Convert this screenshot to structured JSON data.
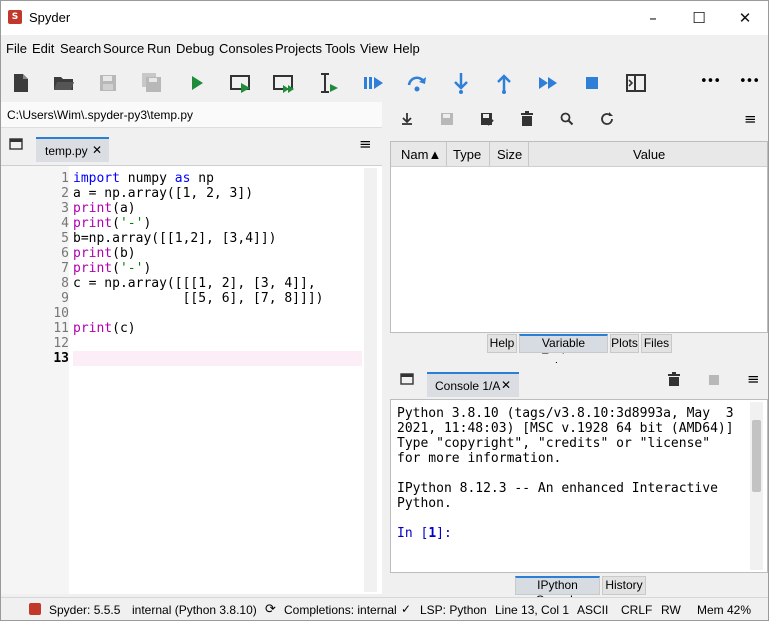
{
  "window": {
    "title": "Spyder",
    "app_icon": "spyder-logo-icon",
    "minimize": "–",
    "maximize": "☐",
    "close": "✕"
  },
  "menu": [
    "File",
    "Edit",
    "Search",
    "Source",
    "Run",
    "Debug",
    "Consoles",
    "Projects",
    "Tools",
    "View",
    "Help"
  ],
  "toolbar": {
    "icons": [
      "new-file-icon",
      "open-file-icon",
      "save-icon",
      "save-all-icon",
      "run-icon",
      "run-cell-icon",
      "run-cell-advance-icon",
      "run-selection-icon",
      "debug-icon",
      "step-over-icon",
      "step-into-icon",
      "step-return-icon",
      "continue-icon",
      "stop-icon",
      "maximize-pane-icon",
      "more-options-icon",
      "more-options-icon"
    ],
    "more1": "•••",
    "more2": "•••"
  },
  "editor": {
    "path": "C:\\Users\\Wim\\.spyder-py3\\temp.py",
    "tab_label": "temp.py",
    "tab_close": "✕",
    "options_icon": "≡",
    "line_numbers": [
      "1",
      "2",
      "3",
      "4",
      "5",
      "6",
      "7",
      "8",
      "9",
      "10",
      "11",
      "12",
      "13"
    ],
    "current_line": "13",
    "lines": [
      [
        {
          "t": "import",
          "c": "kw"
        },
        {
          "t": " numpy ",
          "c": ""
        },
        {
          "t": "as",
          "c": "kw"
        },
        {
          "t": " np",
          "c": ""
        }
      ],
      [
        {
          "t": "a = np.array([",
          "c": ""
        },
        {
          "t": "1",
          "c": "num"
        },
        {
          "t": ", ",
          "c": ""
        },
        {
          "t": "2",
          "c": "num"
        },
        {
          "t": ", ",
          "c": ""
        },
        {
          "t": "3",
          "c": "num"
        },
        {
          "t": "])",
          "c": ""
        }
      ],
      [
        {
          "t": "print",
          "c": "fn"
        },
        {
          "t": "(a)",
          "c": ""
        }
      ],
      [
        {
          "t": "print",
          "c": "fn"
        },
        {
          "t": "(",
          "c": ""
        },
        {
          "t": "'-'",
          "c": "str"
        },
        {
          "t": ")",
          "c": ""
        }
      ],
      [
        {
          "t": "b=np.array([[",
          "c": ""
        },
        {
          "t": "1",
          "c": "num"
        },
        {
          "t": ",",
          "c": ""
        },
        {
          "t": "2",
          "c": "num"
        },
        {
          "t": "], [",
          "c": ""
        },
        {
          "t": "3",
          "c": "num"
        },
        {
          "t": ",",
          "c": ""
        },
        {
          "t": "4",
          "c": "num"
        },
        {
          "t": "]])",
          "c": ""
        }
      ],
      [
        {
          "t": "print",
          "c": "fn"
        },
        {
          "t": "(b)",
          "c": ""
        }
      ],
      [
        {
          "t": "print",
          "c": "fn"
        },
        {
          "t": "(",
          "c": ""
        },
        {
          "t": "'-'",
          "c": "str"
        },
        {
          "t": ")",
          "c": ""
        }
      ],
      [
        {
          "t": "c = np.array([[[",
          "c": ""
        },
        {
          "t": "1",
          "c": "num"
        },
        {
          "t": ", ",
          "c": ""
        },
        {
          "t": "2",
          "c": "num"
        },
        {
          "t": "], [",
          "c": ""
        },
        {
          "t": "3",
          "c": "num"
        },
        {
          "t": ", ",
          "c": ""
        },
        {
          "t": "4",
          "c": "num"
        },
        {
          "t": "]],",
          "c": ""
        }
      ],
      [
        {
          "t": "              [[",
          "c": ""
        },
        {
          "t": "5",
          "c": "num"
        },
        {
          "t": ", ",
          "c": ""
        },
        {
          "t": "6",
          "c": "num"
        },
        {
          "t": "], [",
          "c": ""
        },
        {
          "t": "7",
          "c": "num"
        },
        {
          "t": ", ",
          "c": ""
        },
        {
          "t": "8",
          "c": "num"
        },
        {
          "t": "]]])",
          "c": ""
        }
      ],
      [],
      [
        {
          "t": "print",
          "c": "fn"
        },
        {
          "t": "(c)",
          "c": ""
        }
      ],
      [],
      []
    ]
  },
  "variable_explorer": {
    "toolbar_icons": [
      "import-data-icon",
      "save-data-icon",
      "save-data-as-icon",
      "remove-all-icon",
      "search-icon",
      "refresh-icon"
    ],
    "options_icon": "≡",
    "columns": [
      "Nam▲",
      "Type",
      "Size",
      "Value"
    ],
    "tabs": [
      "Help",
      "Variable Explorer",
      "Plots",
      "Files"
    ],
    "active_tab": "Variable Explorer"
  },
  "console": {
    "tab_label": "Console 1/A",
    "tab_close": "✕",
    "options_icon": "≡",
    "lines": [
      "Python 3.8.10 (tags/v3.8.10:3d8993a, May  3",
      "2021, 11:48:03) [MSC v.1928 64 bit (AMD64)]",
      "Type \"copyright\", \"credits\" or \"license\"",
      "for more information.",
      "",
      "IPython 8.12.3 -- An enhanced Interactive",
      "Python.",
      ""
    ],
    "prompt_prefix": "In [",
    "prompt_num": "1",
    "prompt_suffix": "]:",
    "bottom_tabs": [
      "IPython Console",
      "History"
    ],
    "active_bottom_tab": "IPython Console"
  },
  "status": {
    "version": "Spyder: 5.5.5",
    "interpreter": "internal (Python 3.8.10)",
    "completions": "Completions: internal",
    "lsp": "LSP: Python",
    "position": "Line 13, Col 1",
    "encoding": "ASCII",
    "eol": "CRLF",
    "rw": "RW",
    "mem": "Mem 42%"
  },
  "colors": {
    "accent": "#2a7fd4",
    "run_green": "#1e8c3a",
    "debug_blue": "#2f7fd8",
    "stop_blue": "#2f7fd8",
    "keyword": "#0000ff",
    "builtin": "#b000b0",
    "string": "#008000"
  }
}
